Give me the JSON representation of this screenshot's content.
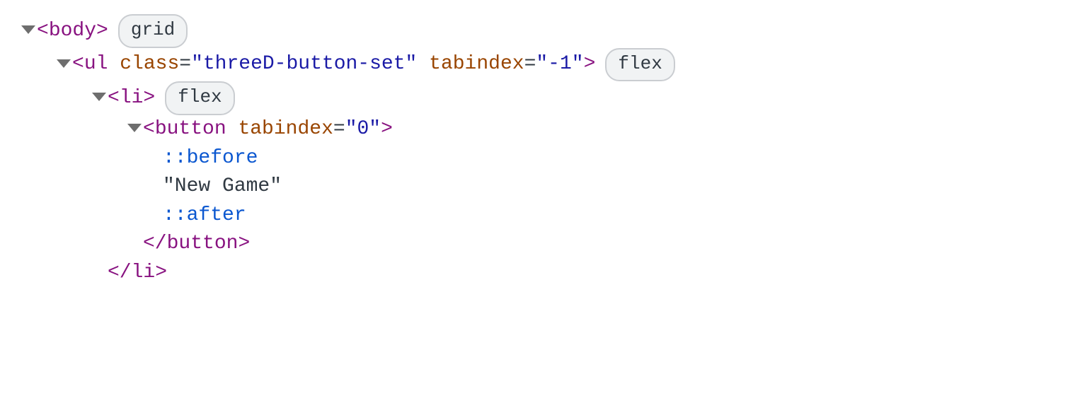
{
  "dom_tree": {
    "line1": {
      "tag": "body",
      "badge": "grid"
    },
    "line2": {
      "tag": "ul",
      "attr1_name": "class",
      "attr1_value": "\"threeD-button-set\"",
      "attr2_name": "tabindex",
      "attr2_value": "\"-1\"",
      "badge": "flex"
    },
    "line3": {
      "tag": "li",
      "badge": "flex"
    },
    "line4": {
      "tag": "button",
      "attr1_name": "tabindex",
      "attr1_value": "\"0\""
    },
    "line5": {
      "pseudo": "::before"
    },
    "line6": {
      "text": "\"New Game\""
    },
    "line7": {
      "pseudo": "::after"
    },
    "line8": {
      "close_tag": "button"
    },
    "line9": {
      "close_tag": "li"
    }
  }
}
